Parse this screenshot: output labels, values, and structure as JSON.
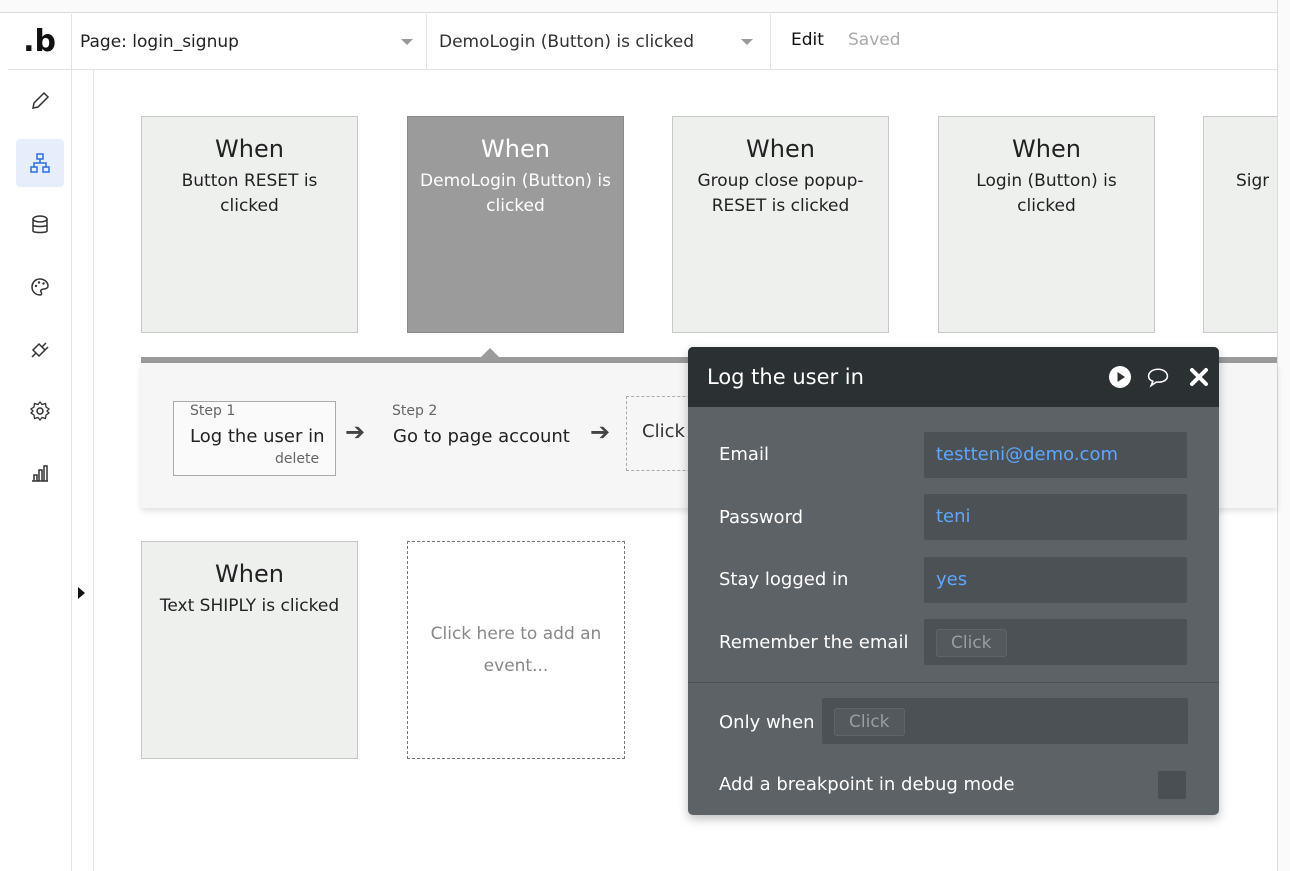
{
  "app": {
    "logo": ".b"
  },
  "header": {
    "page_select": "Page: login_signup",
    "event_select": "DemoLogin (Button) is clicked",
    "edit_label": "Edit",
    "status": "Saved"
  },
  "sidebar": {
    "items": [
      {
        "name": "design",
        "icon": "pencil-icon"
      },
      {
        "name": "workflow",
        "icon": "workflow-icon",
        "active": true
      },
      {
        "name": "data",
        "icon": "database-icon"
      },
      {
        "name": "styles",
        "icon": "palette-icon"
      },
      {
        "name": "plugins",
        "icon": "plug-icon"
      },
      {
        "name": "settings",
        "icon": "gear-icon"
      },
      {
        "name": "logs",
        "icon": "chart-icon"
      }
    ]
  },
  "events": [
    {
      "when": "When",
      "desc": "Button RESET is clicked"
    },
    {
      "when": "When",
      "desc": "DemoLogin (Button) is clicked"
    },
    {
      "when": "When",
      "desc": "Group close popup-RESET is clicked"
    },
    {
      "when": "When",
      "desc": "Login (Button) is clicked"
    },
    {
      "when": "",
      "desc": "SignU"
    },
    {
      "when": "When",
      "desc": "Text SHIPLY is clicked"
    }
  ],
  "add_event": "Click here to add an event...",
  "steps": [
    {
      "label": "Step 1",
      "title": "Log the user in",
      "delete": "delete"
    },
    {
      "label": "Step 2",
      "title": "Go to page account"
    }
  ],
  "add_step": "Click",
  "editor": {
    "title": "Log the user in",
    "fields": [
      {
        "label": "Email",
        "value": "testteni@demo.com"
      },
      {
        "label": "Password",
        "value": "teni"
      },
      {
        "label": "Stay logged in",
        "value": "yes"
      },
      {
        "label": "Remember the email",
        "value": "Click"
      }
    ],
    "only_when_label": "Only when",
    "only_when_value": "Click",
    "breakpoint_label": "Add a breakpoint in debug mode"
  },
  "colors": {
    "accent_value": "#5ea7ff",
    "editor_bg": "#5d6266",
    "editor_head": "#2b3033",
    "selected_card": "#9b9b9b"
  }
}
